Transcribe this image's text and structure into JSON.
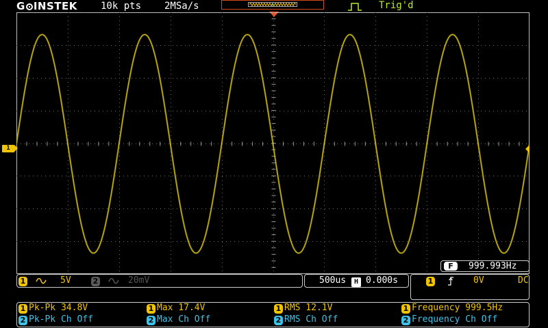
{
  "top": {
    "brand_g": "G",
    "brand_rest": "INSTEK",
    "record_length": "10k pts",
    "sample_rate": "2MSa/s",
    "trigger_state": "Trig'd"
  },
  "screen": {
    "ch1_marker": "1",
    "trace_color": "#c8b400"
  },
  "freq_counter": {
    "icon": "F",
    "value": "999.993Hz"
  },
  "channels": {
    "ch1": {
      "badge": "1",
      "coupling_icon": "ac-wave-icon",
      "scale": "5V"
    },
    "ch2": {
      "badge": "2",
      "coupling_icon": "ac-wave-icon",
      "scale": "20mV"
    }
  },
  "horizontal": {
    "timebase": "500us",
    "position_icon": "H",
    "position": "0.000s"
  },
  "trigger": {
    "source_badge": "1",
    "slope_icon": "rising-edge-icon",
    "level": "0V",
    "coupling": "DC"
  },
  "measurements": {
    "row1": [
      {
        "badge": "1",
        "label": "Pk-Pk 34.8V"
      },
      {
        "badge": "1",
        "label": "Max 17.4V"
      },
      {
        "badge": "1",
        "label": "RMS 12.1V"
      },
      {
        "badge": "1",
        "label": "Frequency 999.5Hz"
      }
    ],
    "row2": [
      {
        "badge": "2",
        "label": "Pk-Pk Ch Off"
      },
      {
        "badge": "2",
        "label": "Max Ch Off"
      },
      {
        "badge": "2",
        "label": "RMS Ch Off"
      },
      {
        "badge": "2",
        "label": "Frequency Ch Off"
      }
    ]
  },
  "colors": {
    "ch1": "#f0c400",
    "ch2": "#3ec1e6",
    "trigger_marker": "#e8542a",
    "trig_state": "#b9ee2d"
  }
}
